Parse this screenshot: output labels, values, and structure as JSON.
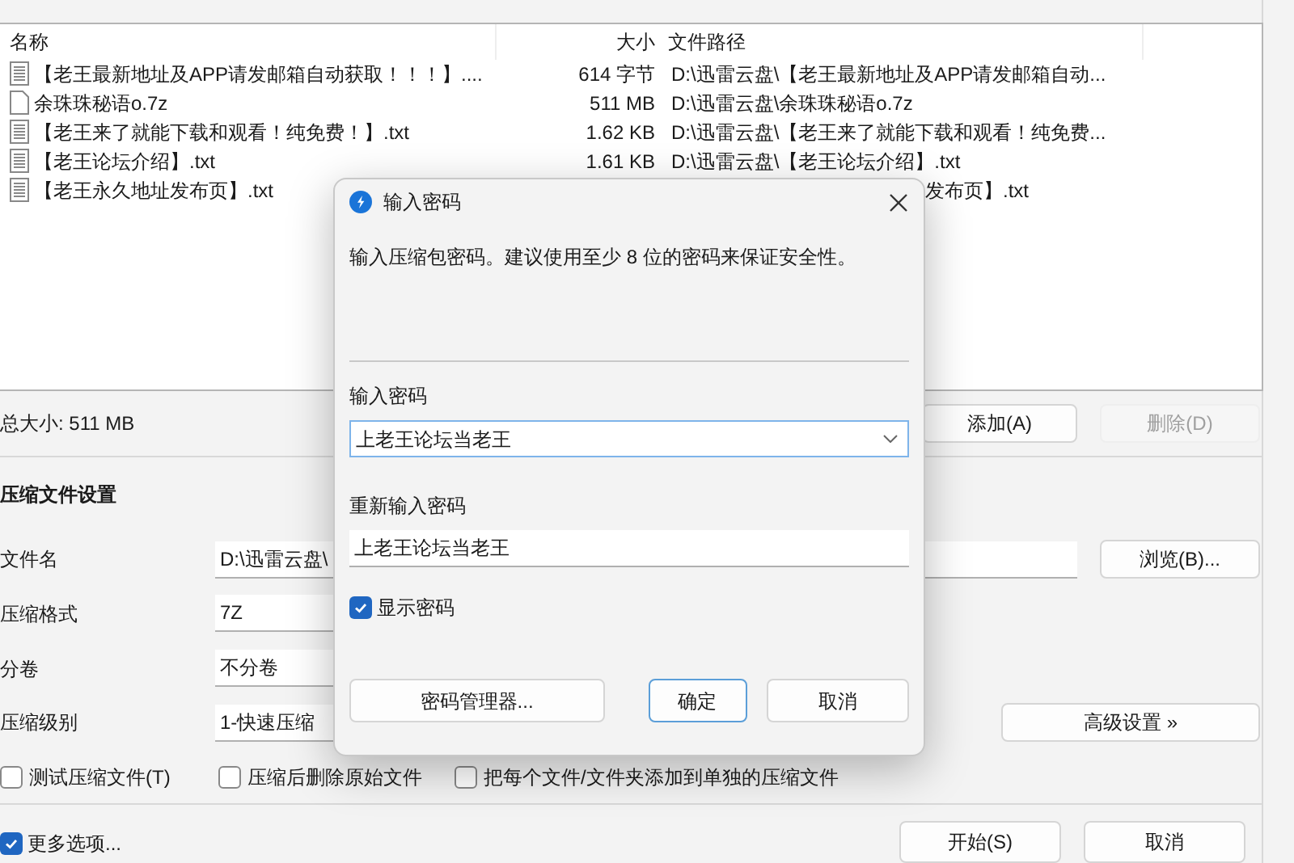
{
  "file_list": {
    "columns": [
      "名称",
      "大小",
      "文件路径"
    ],
    "rows": [
      {
        "kind": "text",
        "name": "【老王最新地址及APP请发邮箱自动获取！！！】....",
        "size": "614 字节",
        "path": "D:\\迅雷云盘\\【老王最新地址及APP请发邮箱自动..."
      },
      {
        "kind": "archive",
        "name": "余珠珠秘语o.7z",
        "size": "511 MB",
        "path": "D:\\迅雷云盘\\余珠珠秘语o.7z"
      },
      {
        "kind": "text",
        "name": "【老王来了就能下载和观看！纯免费！】.txt",
        "size": "1.62 KB",
        "path": "D:\\迅雷云盘\\【老王来了就能下载和观看！纯免费..."
      },
      {
        "kind": "text",
        "name": "【老王论坛介绍】.txt",
        "size": "1.61 KB",
        "path": "D:\\迅雷云盘\\【老王论坛介绍】.txt"
      },
      {
        "kind": "text",
        "name": "【老王永久地址发布页】.txt",
        "path": "发布页】.txt",
        "path_clipped": true
      }
    ]
  },
  "total_size": "总大小: 511 MB",
  "list_buttons": [
    {
      "label": "添加(A)",
      "disabled": false
    },
    {
      "label": "删除(D)",
      "disabled": true
    }
  ],
  "settings": {
    "title": "压缩文件设置",
    "fields": [
      {
        "label": "文件名",
        "value": "D:\\迅雷云盘\\",
        "button": "浏览(B)..."
      },
      {
        "label": "压缩格式",
        "value": "7Z"
      },
      {
        "label": "分卷",
        "value": "不分卷"
      },
      {
        "label": "压缩级别",
        "value": "1-快速压缩",
        "button": "高级设置 »"
      }
    ],
    "options": [
      {
        "label": "测试压缩文件(T)",
        "checked": false
      },
      {
        "label": "压缩后删除原始文件",
        "checked": false
      },
      {
        "label": "把每个文件/文件夹添加到单独的压缩文件",
        "checked": false
      }
    ]
  },
  "more_options": {
    "label": "更多选项...",
    "checked": true
  },
  "footer_buttons": [
    "开始(S)",
    "取消"
  ],
  "dialog": {
    "title": "输入密码",
    "description": "输入压缩包密码。建议使用至少 8 位的密码来保证安全性。",
    "password_label": "输入密码",
    "password_value": "上老王论坛当老王",
    "confirm_label": "重新输入密码",
    "confirm_value": "上老王论坛当老王",
    "show_password": {
      "label": "显示密码",
      "checked": true
    },
    "buttons": [
      {
        "kind": "manager",
        "label": "密码管理器..."
      },
      {
        "kind": "default",
        "label": "确定"
      },
      {
        "kind": "normal",
        "label": "取消"
      }
    ]
  }
}
